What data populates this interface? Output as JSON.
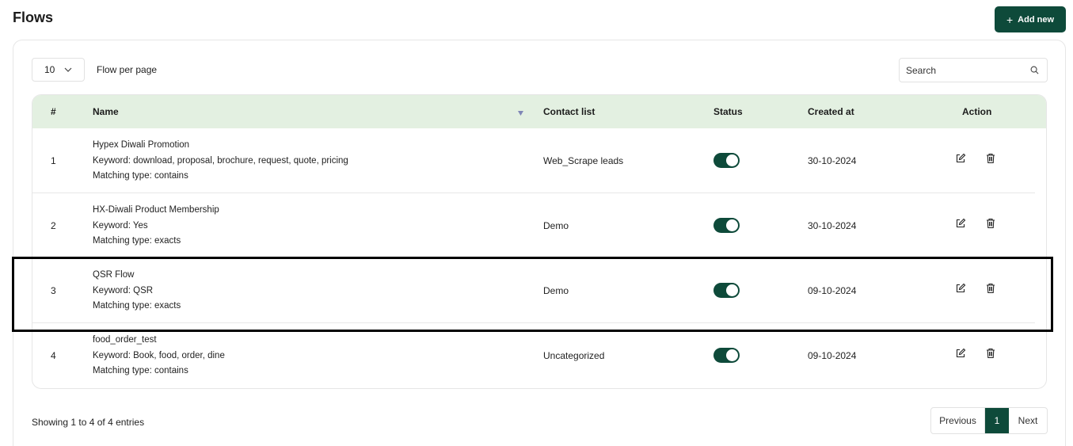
{
  "header": {
    "title": "Flows",
    "add_button": "Add new",
    "add_icon": "+"
  },
  "controls": {
    "per_page_value": "10",
    "per_page_label": "Flow per page",
    "search_placeholder": "Search"
  },
  "table": {
    "columns": [
      "#",
      "Name",
      "Contact list",
      "Status",
      "Created at",
      "Action"
    ],
    "rows": [
      {
        "index": "1",
        "name": "Hypex Diwali Promotion",
        "keyword": "Keyword: download, proposal, brochure, request, quote, pricing",
        "matching": "Matching type: contains",
        "contact_list": "Web_Scrape leads",
        "status": "on",
        "created_at": "30-10-2024"
      },
      {
        "index": "2",
        "name": "HX-Diwali Product Membership",
        "keyword": "Keyword: Yes",
        "matching": "Matching type: exacts",
        "contact_list": "Demo",
        "status": "on",
        "created_at": "30-10-2024"
      },
      {
        "index": "3",
        "name": "QSR Flow",
        "keyword": "Keyword: QSR",
        "matching": "Matching type: exacts",
        "contact_list": "Demo",
        "status": "on",
        "created_at": "09-10-2024"
      },
      {
        "index": "4",
        "name": "food_order_test",
        "keyword": "Keyword: Book, food, order, dine",
        "matching": "Matching type: contains",
        "contact_list": "Uncategorized",
        "status": "on",
        "created_at": "09-10-2024"
      }
    ]
  },
  "footer": {
    "showing": "Showing 1 to 4 of 4 entries",
    "previous": "Previous",
    "current_page": "1",
    "next": "Next"
  },
  "colors": {
    "accent": "#0e4a3a",
    "header_bg": "#e3f0e1"
  },
  "icons": {
    "search": "search-icon",
    "chevron": "chevron-down-icon",
    "edit": "edit-icon",
    "delete": "trash-icon",
    "sort": "sort-icon"
  }
}
